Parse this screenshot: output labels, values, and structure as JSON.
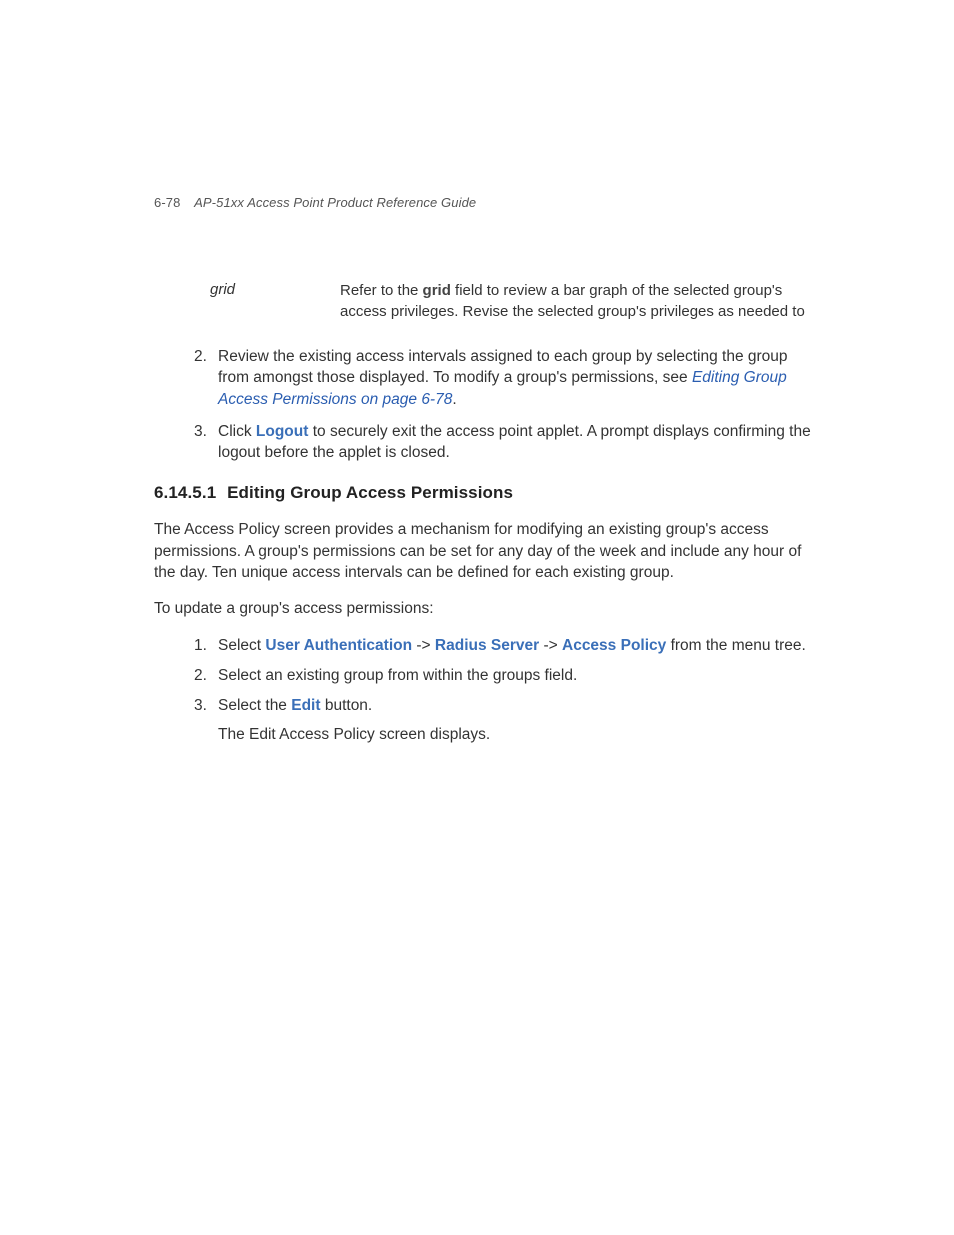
{
  "header": {
    "page_num": "6-78",
    "guide_title": "AP-51xx Access Point Product Reference Guide"
  },
  "definition": {
    "term": "grid",
    "desc_pre": "Refer to the ",
    "desc_bold": "grid",
    "desc_post": " field to review a bar graph of the selected group's access privileges. Revise the selected group's privileges as needed to"
  },
  "list_top": {
    "item2": {
      "num": "2.",
      "text_pre": "Review the existing access intervals assigned to each group by selecting the group from amongst those displayed. To modify a group's permissions, see ",
      "link": "Editing Group Access Permissions on page 6-78",
      "text_post": "."
    },
    "item3": {
      "num": "3.",
      "text_pre": "Click ",
      "bold": "Logout",
      "text_post": " to securely exit the access point applet. A prompt displays confirming the logout before the applet is closed."
    }
  },
  "subsection": {
    "number": "6.14.5.1",
    "title": "Editing Group Access Permissions"
  },
  "para1": "The Access Policy screen provides a mechanism for modifying an existing group's access permissions. A group's permissions can be set for any day of the week and include any hour of the day. Ten unique access intervals can be defined for each existing group.",
  "para2": "To update a group's access permissions:",
  "list_sub": {
    "item1": {
      "num": "1.",
      "pre": "Select ",
      "b1": "User Authentication",
      "sep1": " -> ",
      "b2": "Radius Server",
      "sep2": " -> ",
      "b3": "Access Policy",
      "post": " from the menu tree."
    },
    "item2": {
      "num": "2.",
      "text": "Select an existing group from within the groups field."
    },
    "item3": {
      "num": "3.",
      "pre": "Select the ",
      "bold": "Edit",
      "post": " button."
    },
    "follow": "The Edit Access Policy screen displays."
  }
}
